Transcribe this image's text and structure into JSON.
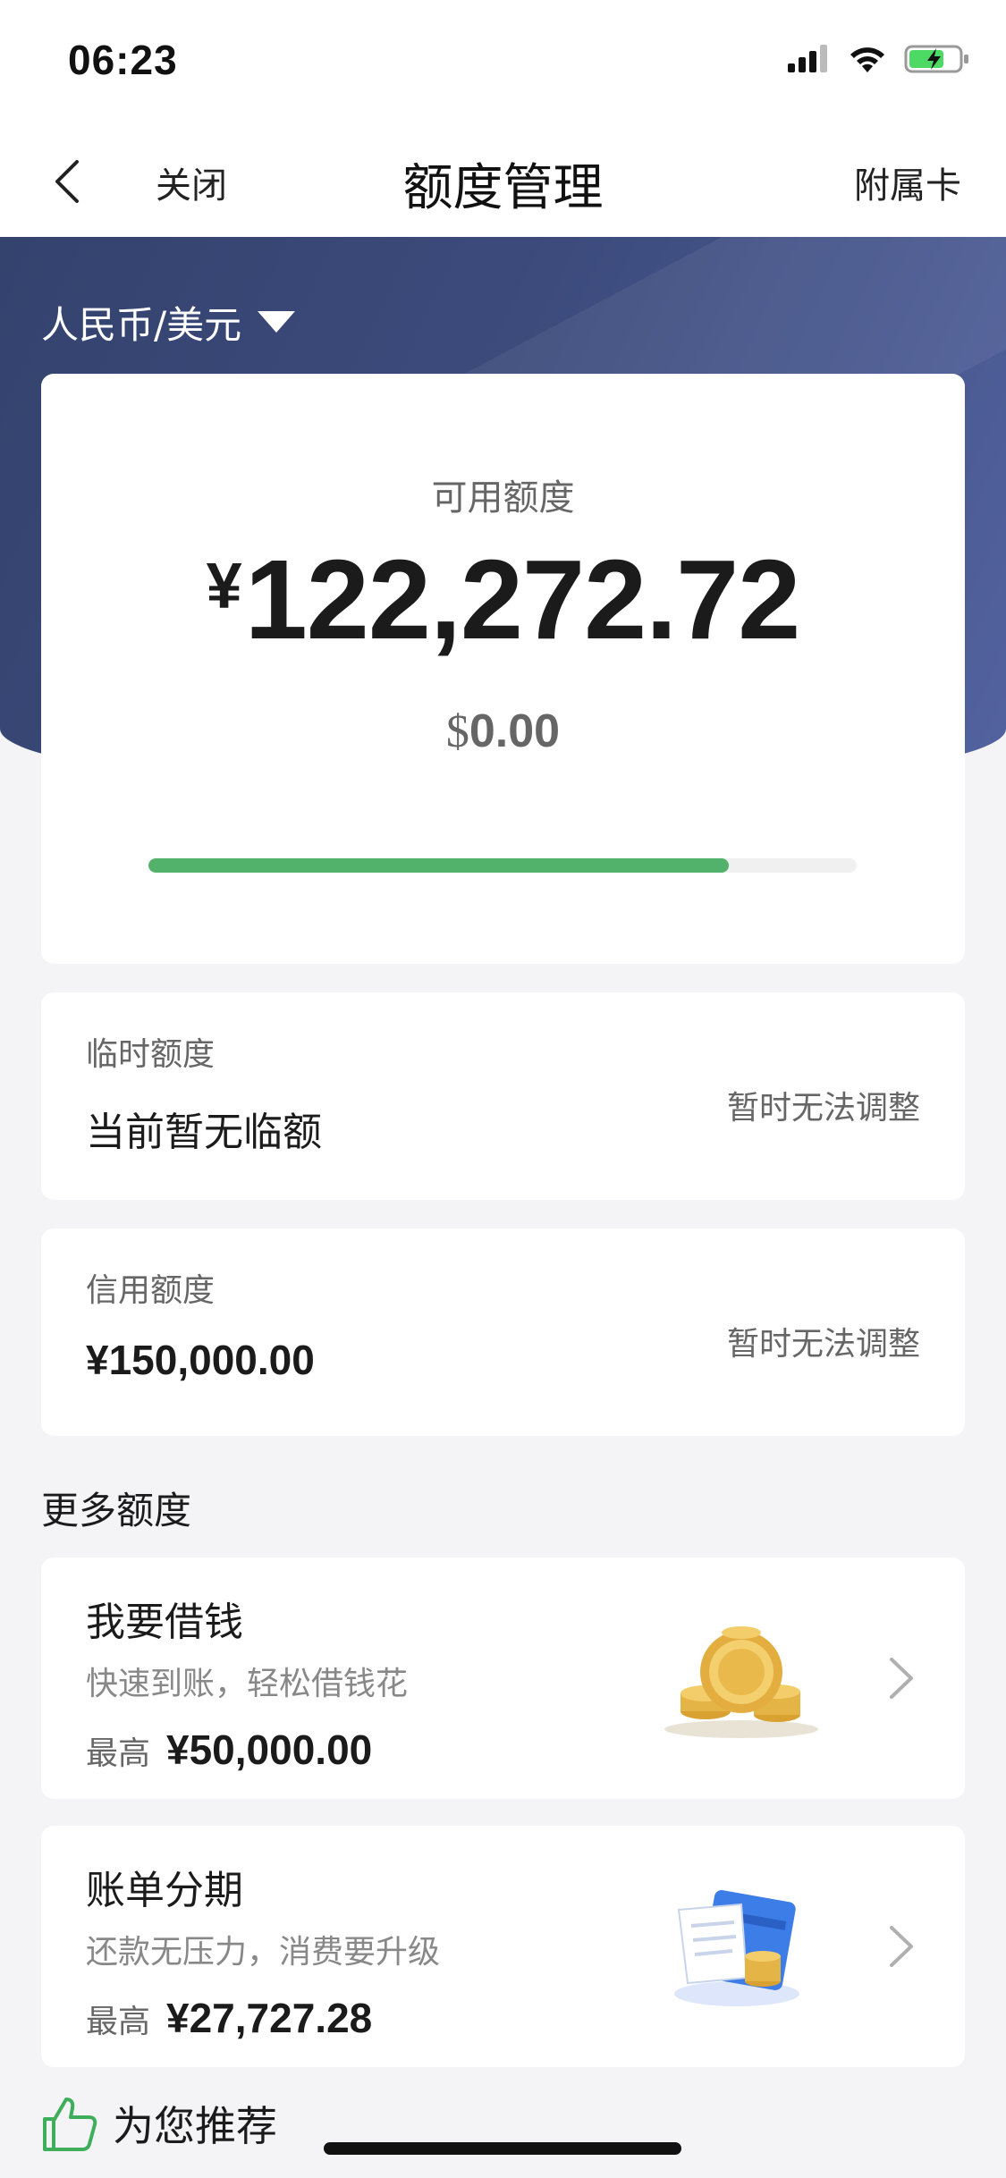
{
  "status_bar": {
    "time": "06:23"
  },
  "nav": {
    "close_label": "关闭",
    "title": "额度管理",
    "right_label": "附属卡"
  },
  "currency_selector": {
    "label": "人民币/美元"
  },
  "available": {
    "label": "可用额度",
    "cny_symbol": "¥",
    "cny_amount": "122,272.72",
    "usd_symbol": "$",
    "usd_amount": "0.00",
    "progress_fraction": 0.82,
    "progress_color": "#52b26b"
  },
  "temp_limit": {
    "label": "临时额度",
    "value": "当前暂无临额",
    "action": "暂时无法调整"
  },
  "credit_limit": {
    "label": "信用额度",
    "value": "¥150,000.00",
    "action": "暂时无法调整"
  },
  "more": {
    "title": "更多额度",
    "offers": [
      {
        "title": "我要借钱",
        "subtitle": "快速到账，轻松借钱花",
        "max_label": "最高",
        "max_value": "¥50,000.00",
        "icon": "coins-icon"
      },
      {
        "title": "账单分期",
        "subtitle": "还款无压力，消费要升级",
        "max_label": "最高",
        "max_value": "¥27,727.28",
        "icon": "bill-card-icon"
      }
    ]
  },
  "recommend": {
    "label": "为您推荐"
  }
}
